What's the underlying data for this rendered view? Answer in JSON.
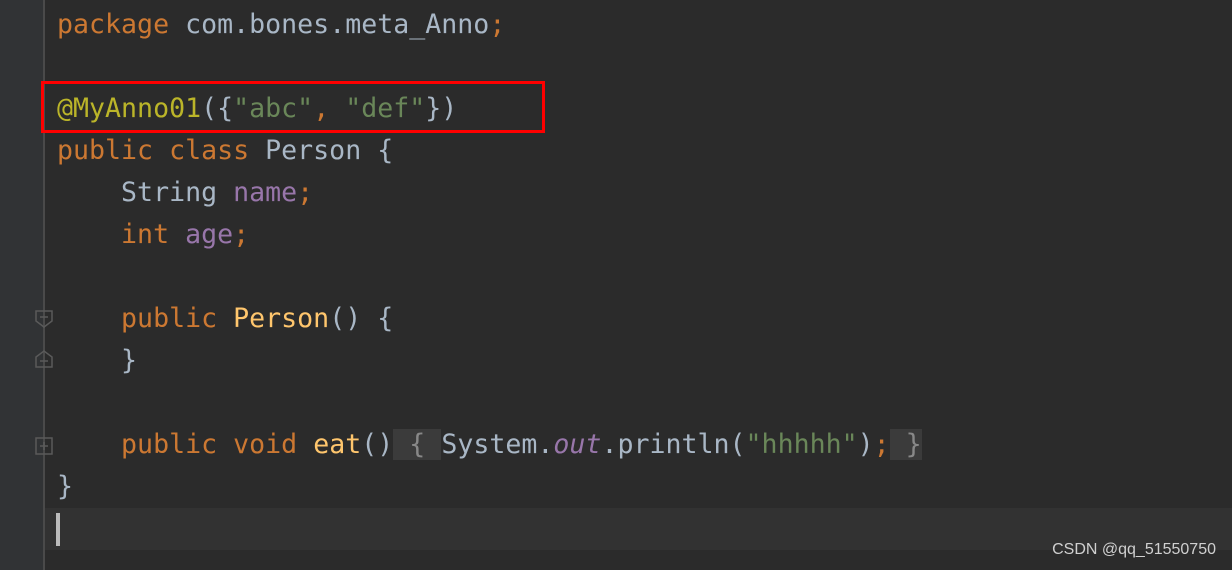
{
  "editor": {
    "lines": [
      [
        [
          "package ",
          "kw"
        ],
        [
          "com.bones.meta_Anno",
          "plain"
        ],
        [
          ";",
          "kw"
        ]
      ],
      [],
      [
        [
          "@MyAnno01",
          "ann"
        ],
        [
          "({",
          "plain"
        ],
        [
          "\"abc\"",
          "str"
        ],
        [
          ", ",
          "kw"
        ],
        [
          "\"def\"",
          "str"
        ],
        [
          "})",
          "plain"
        ]
      ],
      [
        [
          "public class ",
          "kw"
        ],
        [
          "Person {",
          "plain"
        ]
      ],
      [
        [
          "    String ",
          "plain"
        ],
        [
          "name",
          "field"
        ],
        [
          ";",
          "kw"
        ]
      ],
      [
        [
          "    int ",
          "kw"
        ],
        [
          "age",
          "field"
        ],
        [
          ";",
          "kw"
        ]
      ],
      [],
      [
        [
          "    public ",
          "kw"
        ],
        [
          "Person",
          "fn"
        ],
        [
          "() {",
          "plain"
        ]
      ],
      [
        [
          "    }",
          "plain"
        ]
      ],
      [],
      [
        [
          "    public void ",
          "kw"
        ],
        [
          "eat",
          "fn"
        ],
        [
          "()",
          "plain"
        ],
        [
          " { ",
          "fold"
        ],
        [
          "System.",
          "plain"
        ],
        [
          "out",
          "sfield"
        ],
        [
          ".println(",
          "plain"
        ],
        [
          "\"hhhhh\"",
          "str"
        ],
        [
          ")",
          "plain"
        ],
        [
          ";",
          "kw"
        ],
        [
          " }",
          "fold"
        ]
      ],
      [
        [
          "}",
          "plain"
        ]
      ],
      []
    ],
    "highlighted_line": 3,
    "colors": {
      "background": "#2b2b2b",
      "keyword": "#cc7832",
      "string": "#6a8759",
      "annotation": "#bbb529",
      "field": "#9876aa",
      "method": "#ffc66d",
      "highlight_box": "#ff0000"
    },
    "fold_markers": [
      "fold-collapse-icon",
      "fold-end-icon",
      "fold-expand-icon"
    ]
  },
  "watermark": "CSDN @qq_51550750"
}
